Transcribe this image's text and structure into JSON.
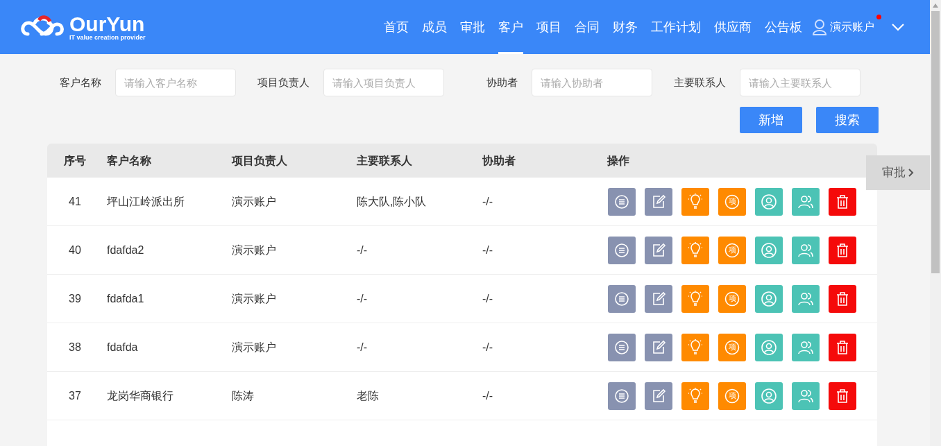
{
  "header": {
    "logo_name": "OurYun",
    "logo_tagline": "IT value creation provider",
    "nav": [
      {
        "label": "首页",
        "selected": false
      },
      {
        "label": "成员",
        "selected": false
      },
      {
        "label": "审批",
        "selected": false
      },
      {
        "label": "客户",
        "selected": true
      },
      {
        "label": "项目",
        "selected": false
      },
      {
        "label": "合同",
        "selected": false
      },
      {
        "label": "财务",
        "selected": false
      },
      {
        "label": "工作计划",
        "selected": false
      },
      {
        "label": "供应商",
        "selected": false
      },
      {
        "label": "公告板",
        "selected": false
      }
    ],
    "user": {
      "name": "演示账户",
      "unread": true
    }
  },
  "filters": [
    {
      "label": "客户名称",
      "placeholder": "请输入客户名称"
    },
    {
      "label": "项目负责人",
      "placeholder": "请输入项目负责人"
    },
    {
      "label": "协助者",
      "placeholder": "请输入协助者"
    },
    {
      "label": "主要联系人",
      "placeholder": "请输入主要联系人"
    }
  ],
  "buttons": [
    "新增",
    "搜索"
  ],
  "side_tab": "审批",
  "table": {
    "columns": [
      "序号",
      "客户名称",
      "项目负责人",
      "主要联系人",
      "协助者",
      "操作"
    ],
    "actions": [
      {
        "kind": "detail"
      },
      {
        "kind": "edit"
      },
      {
        "kind": "idea"
      },
      {
        "kind": "project"
      },
      {
        "kind": "person"
      },
      {
        "kind": "people"
      },
      {
        "kind": "delete"
      }
    ],
    "rows": [
      {
        "cells": [
          "41",
          "坪山江岭派出所",
          "演示账户",
          "陈大队,陈小队",
          "-/-"
        ],
        "project_label": "项"
      },
      {
        "cells": [
          "40",
          "fdafda2",
          "演示账户",
          "-/-",
          "-/-"
        ],
        "project_label": "项"
      },
      {
        "cells": [
          "39",
          "fdafda1",
          "演示账户",
          "-/-",
          "-/-"
        ],
        "project_label": "项"
      },
      {
        "cells": [
          "38",
          "fdafda",
          "演示账户",
          "-/-",
          "-/-"
        ],
        "project_label": "项"
      },
      {
        "cells": [
          "37",
          "龙岗华商银行",
          "陈涛",
          "老陈",
          "-/-"
        ],
        "project_label": "项"
      }
    ]
  }
}
